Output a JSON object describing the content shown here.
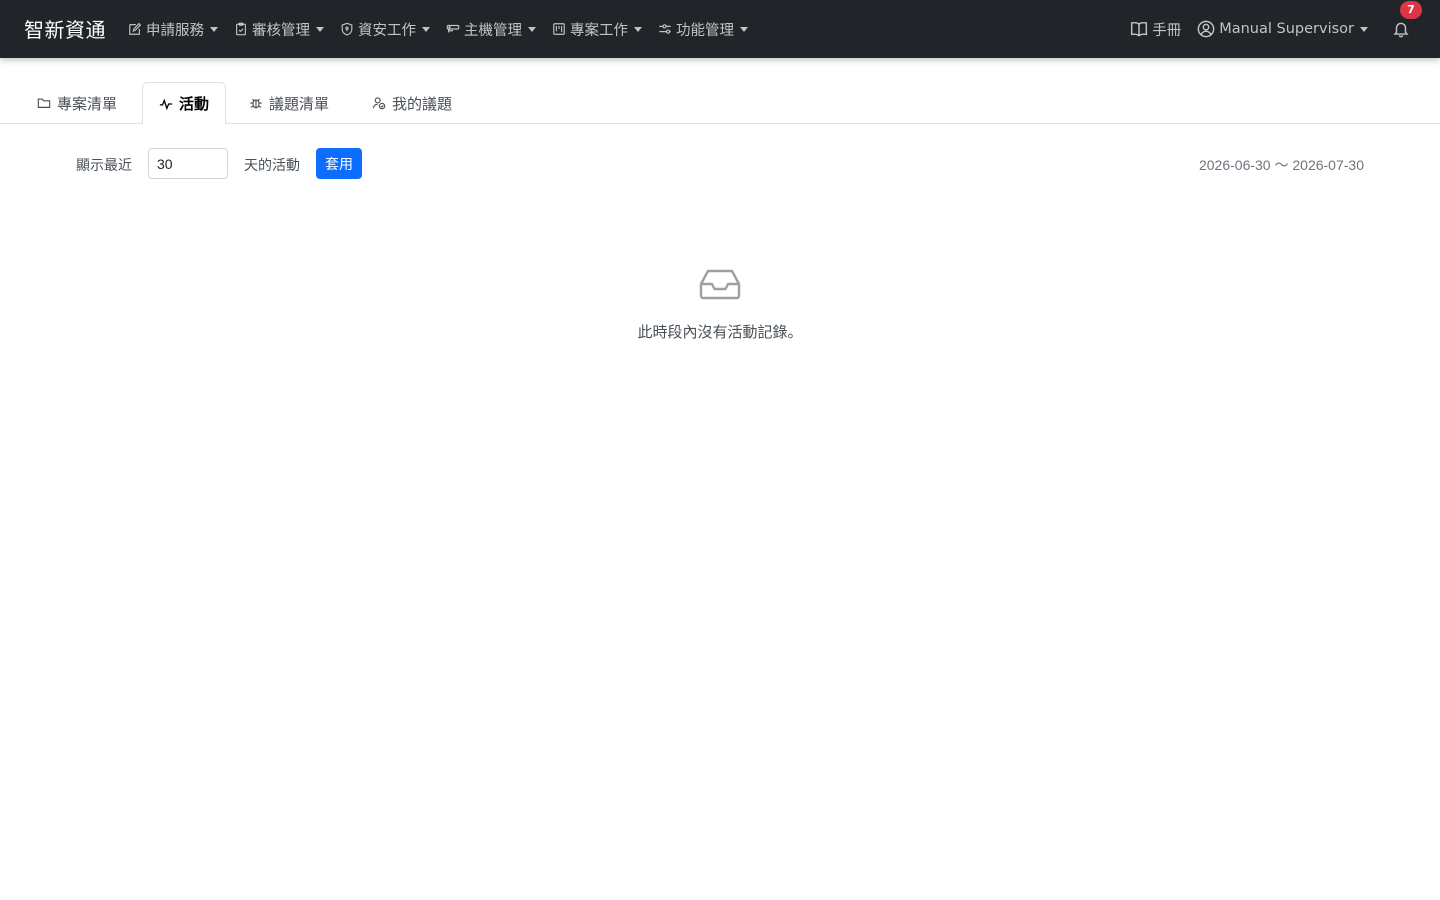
{
  "navbar": {
    "brand": "智新資通",
    "menus": [
      {
        "label": "申請服務",
        "icon": "edit-icon"
      },
      {
        "label": "審核管理",
        "icon": "clipboard-check-icon"
      },
      {
        "label": "資安工作",
        "icon": "shield-icon"
      },
      {
        "label": "主機管理",
        "icon": "server-icon"
      },
      {
        "label": "專案工作",
        "icon": "kanban-icon"
      },
      {
        "label": "功能管理",
        "icon": "sliders-icon"
      }
    ],
    "manual_label": "手冊",
    "user_name": "Manual Supervisor",
    "notification_count": "7"
  },
  "tabs": [
    {
      "label": "專案清單",
      "icon": "folder-icon",
      "active": false
    },
    {
      "label": "活動",
      "icon": "activity-icon",
      "active": true
    },
    {
      "label": "議題清單",
      "icon": "bug-icon",
      "active": false
    },
    {
      "label": "我的議題",
      "icon": "person-check-icon",
      "active": false
    }
  ],
  "filter": {
    "prefix_label": "顯示最近",
    "days_value": "30",
    "suffix_label": "天的活動",
    "apply_label": "套用",
    "date_range": "2026-06-30 ～ 2026-07-30"
  },
  "empty_state": {
    "icon": "inbox-icon",
    "message": "此時段內沒有活動記錄。"
  },
  "colors": {
    "navbar_bg": "#212529",
    "primary": "#0d6efd",
    "badge": "#dc3545"
  }
}
